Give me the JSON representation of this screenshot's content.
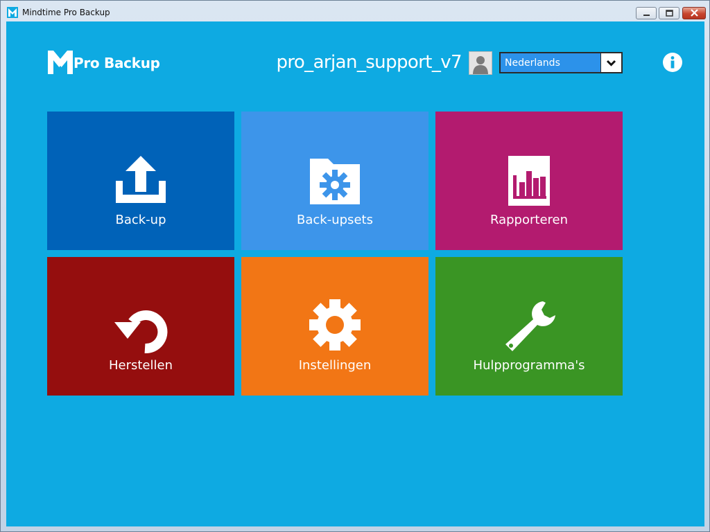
{
  "window": {
    "title": "Mindtime Pro Backup",
    "controls": [
      "minimize",
      "maximize",
      "close"
    ]
  },
  "header": {
    "logo_text": "Pro Backup",
    "username": "pro_arjan_support_v7",
    "language": {
      "selected": "Nederlands"
    },
    "icons": [
      "user-avatar-icon",
      "info-icon"
    ]
  },
  "colors": {
    "background": "#0eaae2",
    "backup": "#0062b8",
    "backupsets": "#3d95ea",
    "reports": "#b31b6f",
    "restore": "#950e0e",
    "settings": "#f27615",
    "utilities": "#3a9524"
  },
  "tiles": [
    {
      "label": "Back-up",
      "icon": "upload-icon"
    },
    {
      "label": "Back-upsets",
      "icon": "folder-gear-icon"
    },
    {
      "label": "Rapporteren",
      "icon": "bar-chart-icon"
    },
    {
      "label": "Herstellen",
      "icon": "restore-arrow-icon"
    },
    {
      "label": "Instellingen",
      "icon": "gear-icon"
    },
    {
      "label": "Hulpprogramma's",
      "icon": "wrench-icon"
    }
  ]
}
